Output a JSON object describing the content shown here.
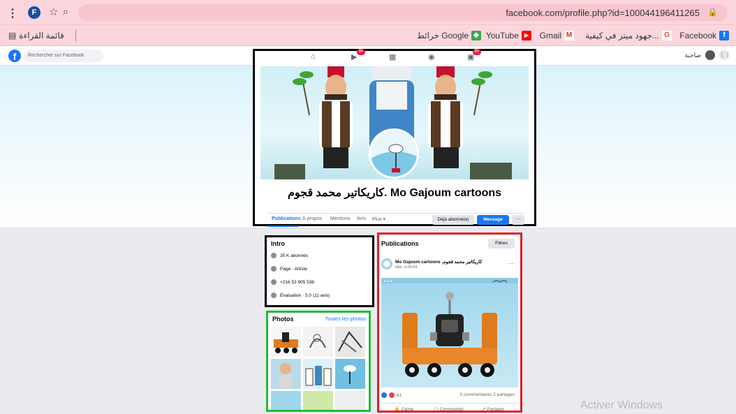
{
  "browser": {
    "profile_initial": "F",
    "url": "facebook.com/profile.php?id=100044196411265",
    "reading_list": "قائمة القراءة",
    "bookmarks": [
      {
        "label": "Facebook",
        "icon": "facebook-icon",
        "color": "#1877f2",
        "glyph": "f"
      },
      {
        "label": "جهود ميتز في كيفية...",
        "icon": "google-icon",
        "color": "#ea4335",
        "glyph": "G"
      },
      {
        "label": "Gmail",
        "icon": "gmail-icon",
        "color": "#d93025",
        "glyph": "M"
      },
      {
        "label": "YouTube",
        "icon": "youtube-icon",
        "color": "#ff0000",
        "glyph": "▶"
      },
      {
        "label": "خرائط Google",
        "icon": "maps-icon",
        "color": "#34a853",
        "glyph": "◆"
      }
    ]
  },
  "fb": {
    "search_placeholder": "Rechercher sur Facebook",
    "nav_badges": [
      "9+",
      "9+"
    ],
    "account_label": "صاحبة"
  },
  "profile": {
    "name": "كاريكاتير محمد قجوم. Mo Gajoum cartoons",
    "tabs": [
      "Publications",
      "À propos",
      "Mentions",
      "Avis",
      "Plus ▾"
    ],
    "subscribed_label": "Déjà abonné(e)",
    "message_label": "Message",
    "more_label": "···"
  },
  "intro": {
    "title": "Intro",
    "rows": [
      {
        "icon": "followers-icon",
        "text": "35 K abonnés"
      },
      {
        "icon": "info-icon",
        "text": "Page · Artiste"
      },
      {
        "icon": "phone-icon",
        "text": "+216 53 905 536"
      },
      {
        "icon": "star-icon",
        "text": "Évaluation · 5,0 (11 avis)"
      }
    ]
  },
  "photos": {
    "title": "Photos",
    "link": "Toutes les photos"
  },
  "publications": {
    "title": "Publications",
    "filters_label": "Filtres",
    "post": {
      "author": "Mo Gajoum cartoons .كاريكاتير محمد قجوم",
      "time": "Hier, à 04:54 · ",
      "reaction_count": "61",
      "comments_shares": "3 commentaires  2 partages",
      "actions": [
        "J'aime",
        "Commenter",
        "Partager"
      ]
    }
  },
  "watermark": "Activer Windows"
}
